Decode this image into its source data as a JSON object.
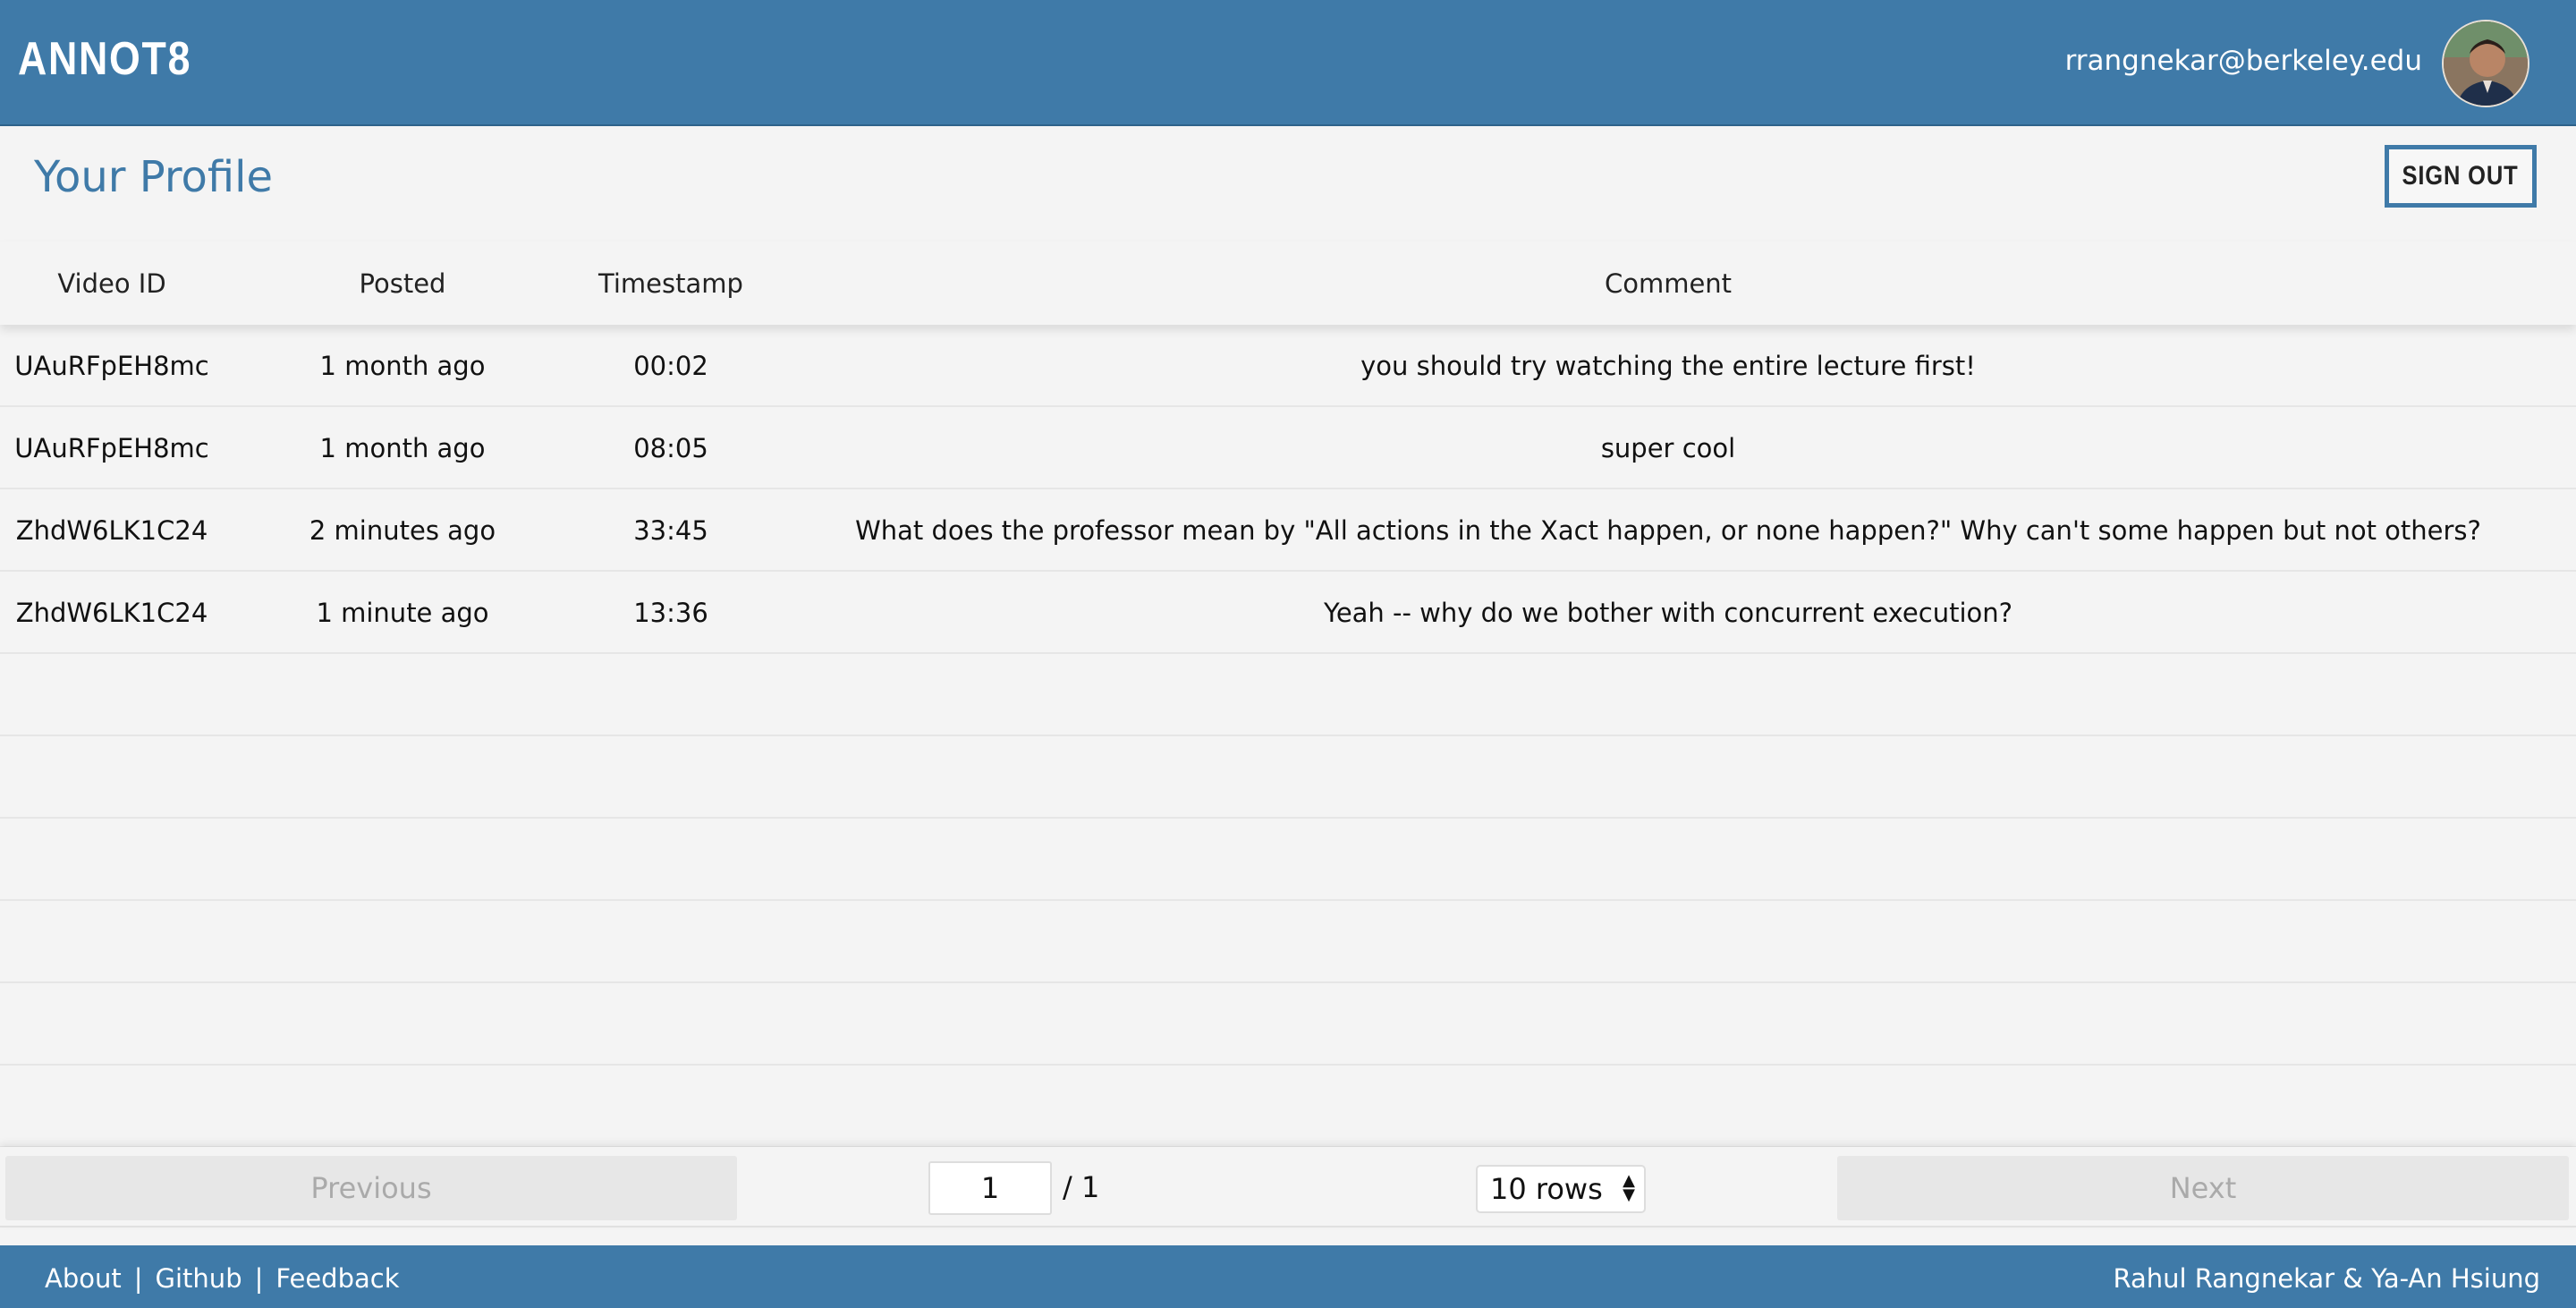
{
  "header": {
    "brand": "ANNOT8",
    "user_email": "rrangnekar@berkeley.edu"
  },
  "profile": {
    "title": "Your Profile",
    "sign_out_label": "SIGN OUT"
  },
  "table": {
    "columns": [
      "Video ID",
      "Posted",
      "Timestamp",
      "Comment"
    ],
    "rows": [
      {
        "video_id": "UAuRFpEH8mc",
        "posted": "1 month ago",
        "timestamp": "00:02",
        "comment": "you should try watching the entire lecture first!"
      },
      {
        "video_id": "UAuRFpEH8mc",
        "posted": "1 month ago",
        "timestamp": "08:05",
        "comment": "super cool"
      },
      {
        "video_id": "ZhdW6LK1C24",
        "posted": "2 minutes ago",
        "timestamp": "33:45",
        "comment": "What does the professor mean by \"All actions in the Xact happen, or none happen?\" Why can't some happen but not others?"
      },
      {
        "video_id": "ZhdW6LK1C24",
        "posted": "1 minute ago",
        "timestamp": "13:36",
        "comment": "Yeah -- why do we bother with concurrent execution?"
      }
    ]
  },
  "pagination": {
    "previous_label": "Previous",
    "next_label": "Next",
    "current_page": "1",
    "total_pages_text": "/ 1",
    "rows_per_page": "10 rows"
  },
  "footer": {
    "links": [
      "About",
      "Github",
      "Feedback"
    ],
    "separator": "|",
    "credits": "Rahul Rangnekar & Ya-An Hsiung"
  },
  "colors": {
    "primary": "#3f7aa8",
    "background": "#f4f4f4"
  }
}
